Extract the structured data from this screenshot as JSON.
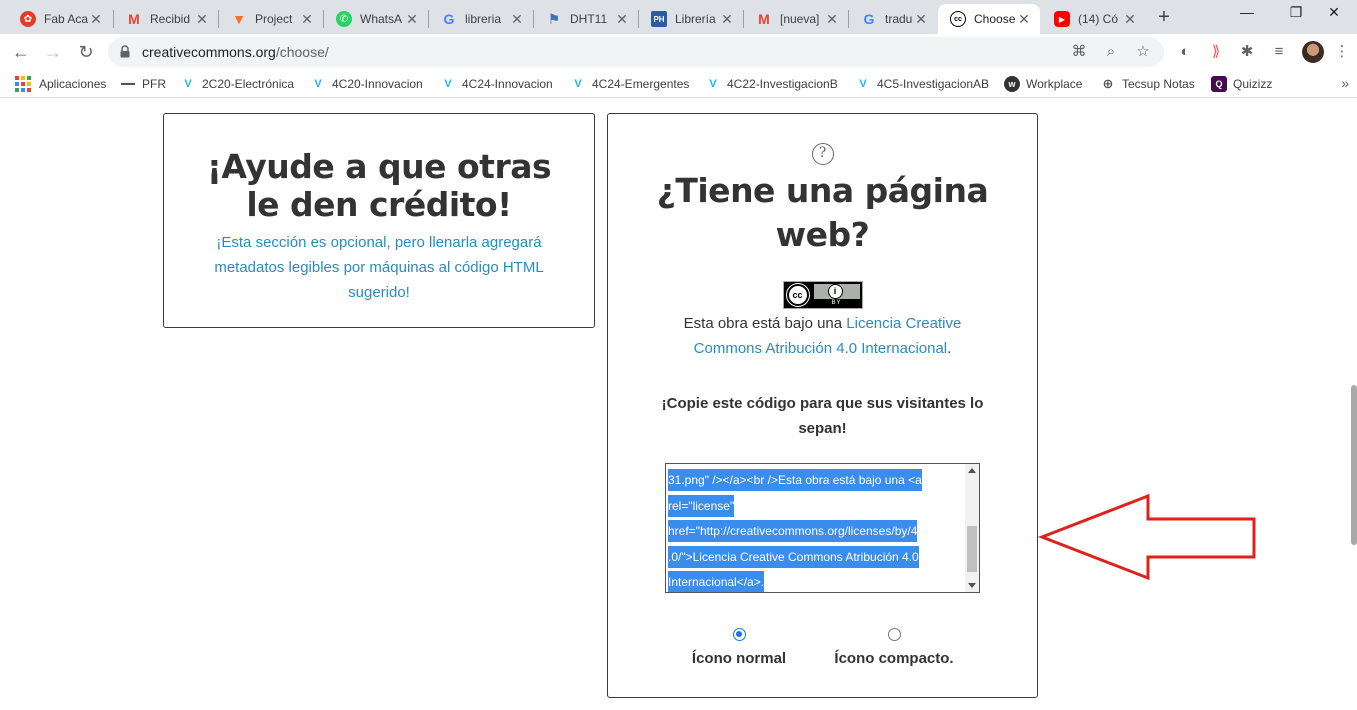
{
  "browser": {
    "tabs": [
      {
        "title": "Fab Aca",
        "icon": "fab-academy-icon",
        "color": "#e23d28"
      },
      {
        "title": "Recibid",
        "icon": "gmail-icon",
        "color": "#ea4335"
      },
      {
        "title": "Project",
        "icon": "gitlab-icon",
        "color": "#fc6d26"
      },
      {
        "title": "WhatsA",
        "icon": "whatsapp-icon",
        "color": "#25d366"
      },
      {
        "title": "libreria",
        "icon": "google-icon",
        "color": "#4285f4"
      },
      {
        "title": "DHT11",
        "icon": "site-icon",
        "color": "#3f6fb6"
      },
      {
        "title": "Librería",
        "icon": "ph-icon",
        "color": "#2a5ba8"
      },
      {
        "title": "[nueva]",
        "icon": "gmail-icon",
        "color": "#ea4335"
      },
      {
        "title": "traducto",
        "icon": "google-icon",
        "color": "#4285f4"
      },
      {
        "title": "Choose",
        "icon": "creative-commons-icon",
        "color": "#000000",
        "active": true
      },
      {
        "title": "(14) Có",
        "icon": "youtube-icon",
        "color": "#ff0000"
      }
    ],
    "url_host": "creativecommons.org",
    "url_path": "/choose/",
    "bookmarks": [
      {
        "label": "Aplicaciones",
        "icon": "apps-grid-icon"
      },
      {
        "label": "PFR",
        "icon": "pfr-icon"
      },
      {
        "label": "2C20-Electrónica",
        "icon": "vimeo-icon"
      },
      {
        "label": "4C20-Innovacion",
        "icon": "vimeo-icon"
      },
      {
        "label": "4C24-Innovacion",
        "icon": "vimeo-icon"
      },
      {
        "label": "4C24-Emergentes",
        "icon": "vimeo-icon"
      },
      {
        "label": "4C22-InvestigacionB",
        "icon": "vimeo-icon"
      },
      {
        "label": "4C5-InvestigacionAB",
        "icon": "vimeo-icon"
      },
      {
        "label": "Workplace",
        "icon": "workplace-icon"
      },
      {
        "label": "Tecsup Notas",
        "icon": "globe-icon"
      },
      {
        "label": "Quizizz",
        "icon": "quizizz-icon"
      }
    ]
  },
  "left_card": {
    "title_line1": "¡Ayude a que otras",
    "title_line2": "le den crédito!",
    "subtitle": "¡Esta sección es opcional, pero llenarla agregará metadatos legibles por máquinas al código HTML sugerido!"
  },
  "right_card": {
    "help_symbol": "?",
    "title_line1": "¿Tiene una página",
    "title_line2": "web?",
    "badge_cc": "cc",
    "badge_by": "BY",
    "license_prefix": "Esta obra está bajo una ",
    "license_link": "Licencia Creative Commons Atribución 4.0 Internacional",
    "license_suffix": ".",
    "copy_heading": "¡Copie este código para que sus visitantes lo sepan!",
    "code_lines": [
      "31.png\" /></a><br />Esta obra está bajo una <a",
      "rel=\"license\"",
      "href=\"http://creativecommons.org/licenses/by/4",
      ".0/\">Licencia Creative Commons Atribución 4.0",
      "Internacional</a>."
    ],
    "radio_normal": "Ícono normal",
    "radio_compact": "Ícono compacto."
  },
  "colors": {
    "link": "#2b8bbf",
    "selection": "#3b8ded",
    "arrow": "#e0201b"
  }
}
